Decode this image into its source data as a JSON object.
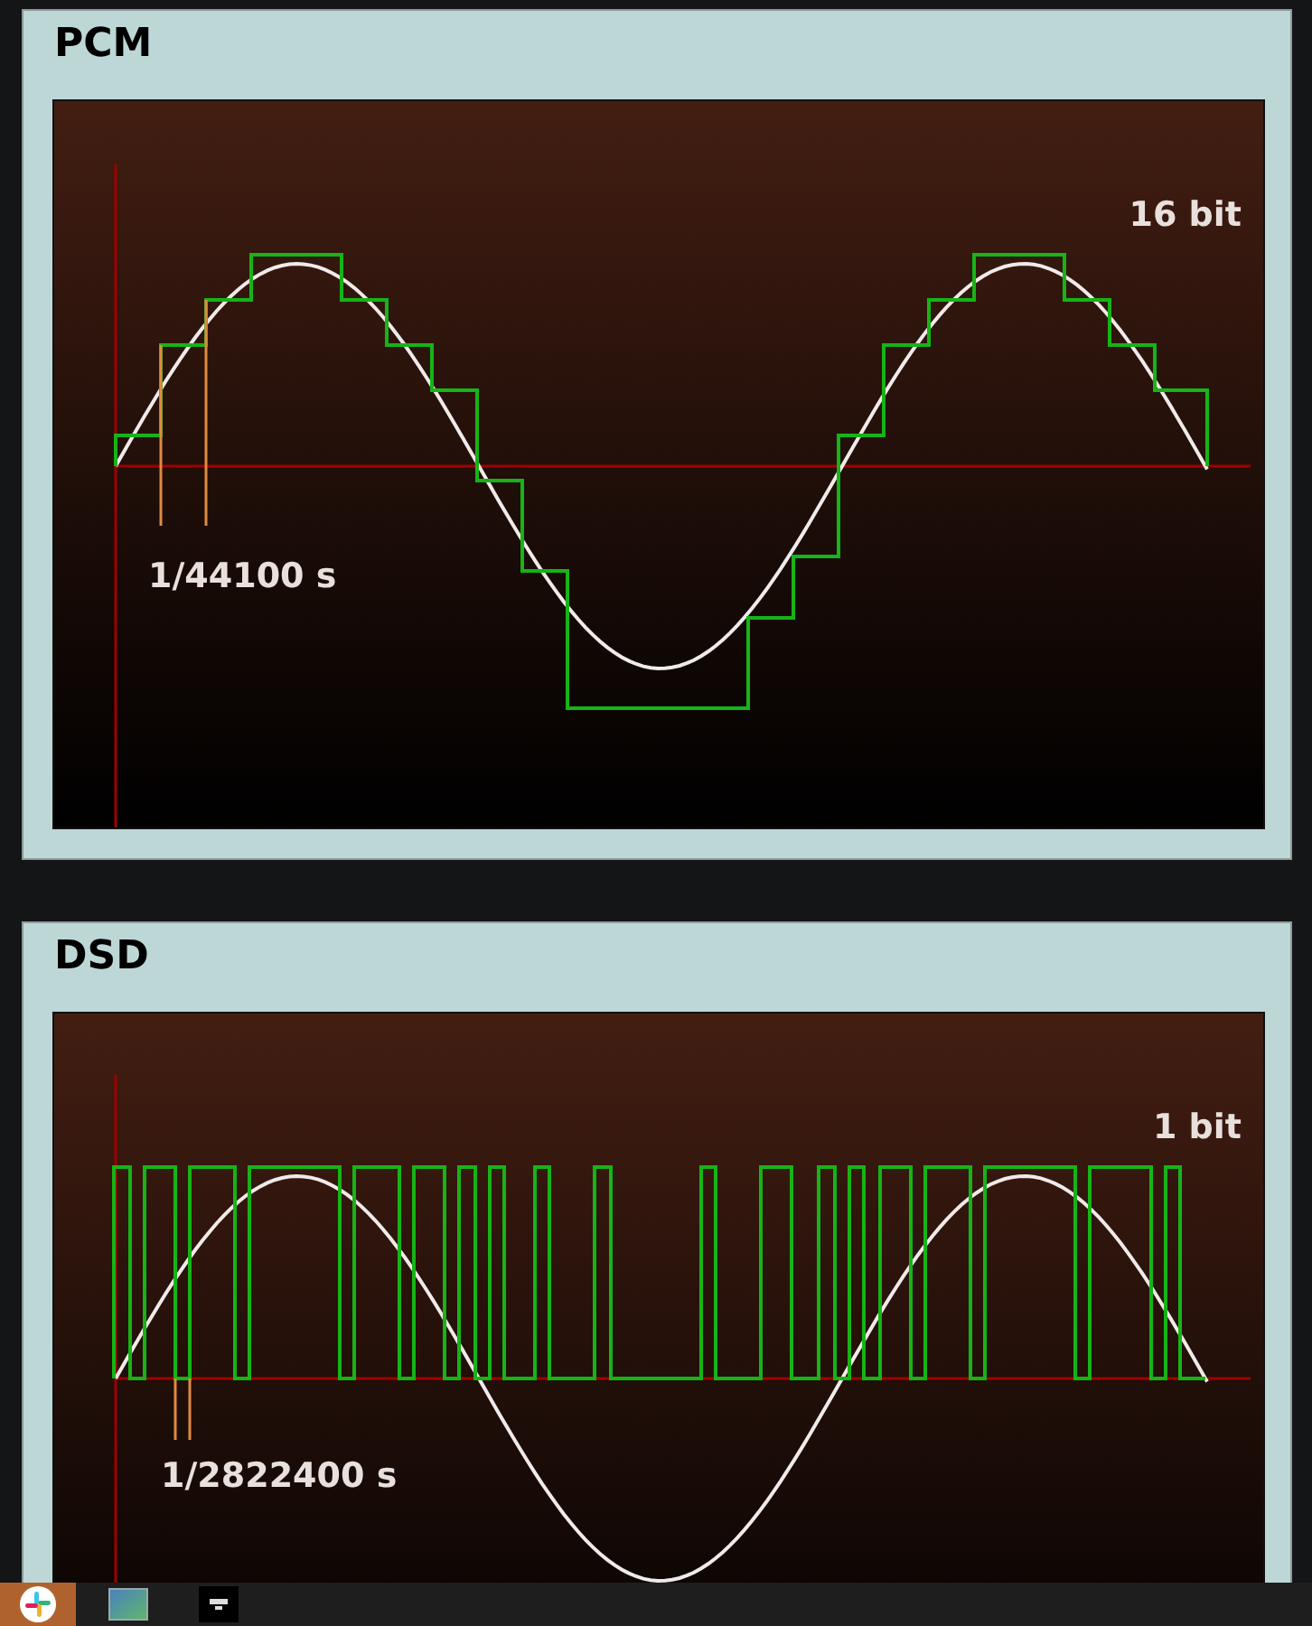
{
  "panels": [
    {
      "title": "PCM",
      "kind": "pcm",
      "bit_depth_label": "16 bit",
      "sample_period_label": "1/44100 s"
    },
    {
      "title": "DSD",
      "kind": "dsd",
      "bit_depth_label": "1 bit",
      "sample_period_label": "1/2822400 s"
    }
  ],
  "taskbar": [
    {
      "selected": true
    },
    {
      "selected": false
    },
    {
      "selected": false
    }
  ]
}
